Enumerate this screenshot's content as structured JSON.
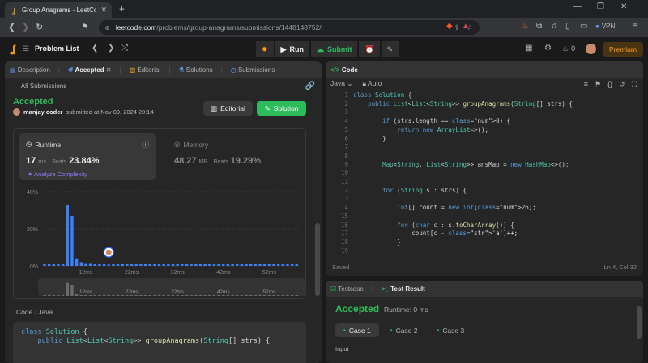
{
  "browser": {
    "tab_title": "Group Anagrams - LeetCode",
    "url_host": "leetcode.com",
    "url_path": "/problems/group-anagrams/submissions/1448148752/",
    "vpn_label": "VPN"
  },
  "lc_nav": {
    "problem_list": "Problem List",
    "run": "Run",
    "submit": "Submit",
    "streak": "0",
    "premium": "Premium"
  },
  "left_tabs": {
    "description": "Description",
    "accepted": "Accepted",
    "editorial": "Editorial",
    "solutions": "Solutions",
    "submissions": "Submissions"
  },
  "submission": {
    "back": "All Submissions",
    "status": "Accepted",
    "user": "manjay coder",
    "submitted_text": "submitted at Nov 09, 2024 20:14",
    "editorial_btn": "Editorial",
    "solution_btn": "Solution",
    "runtime": {
      "label": "Runtime",
      "value": "17",
      "unit": "ms",
      "beats_label": "Beats",
      "beats": "23.84%",
      "analyze": "Analyze Complexity"
    },
    "memory": {
      "label": "Memory",
      "value": "48.27",
      "unit": "MB",
      "beats_label": "Beats",
      "beats": "19.29%"
    },
    "code_label": "Code",
    "code_lang": "Java",
    "code_preview": [
      "class Solution {",
      "    public List<List<String>> groupAnagrams(String[] strs) {"
    ]
  },
  "chart_data": {
    "type": "bar",
    "yticks": [
      "40%",
      "20%",
      "0%"
    ],
    "ylim": [
      0,
      40
    ],
    "xticks": [
      "12ms",
      "22ms",
      "32ms",
      "42ms",
      "52ms"
    ],
    "x": [
      3,
      4,
      5,
      6,
      7,
      8,
      9,
      10,
      11,
      12,
      13,
      14,
      15,
      16,
      17,
      18,
      19,
      20,
      21,
      22,
      23,
      24,
      25,
      26,
      27,
      28,
      29,
      30,
      31,
      32,
      33,
      34,
      35,
      36,
      37,
      38,
      39,
      40,
      41,
      42,
      43,
      44,
      45,
      46,
      47,
      48,
      49,
      50,
      51,
      52,
      53,
      54,
      55,
      56,
      57,
      58
    ],
    "values": [
      1,
      1,
      1,
      1,
      1,
      33,
      27,
      4,
      2,
      1.5,
      1.5,
      1,
      1,
      1,
      1,
      1,
      1,
      1,
      1,
      1,
      1,
      1,
      1,
      1,
      1,
      1,
      1,
      1,
      1,
      1,
      1,
      1,
      1,
      1,
      1,
      1,
      1,
      1,
      1,
      1,
      1,
      1,
      1,
      1,
      1,
      1,
      1,
      1,
      1,
      1,
      1,
      1,
      1,
      1,
      1,
      1
    ],
    "highlight_x": 17,
    "highlight_value": 3
  },
  "code_panel": {
    "title": "Code",
    "lang": "Java",
    "mode": "Auto",
    "saved": "Saved",
    "cursor": "Ln 4, Col 32",
    "line_numbers": [
      "1",
      "2",
      "3",
      "4",
      "5",
      "6",
      "7",
      "8",
      "9",
      "10",
      "11",
      "12",
      "13",
      "14",
      "15",
      "16",
      "17",
      "18",
      "19"
    ],
    "lines": [
      "class Solution {",
      "    public List<List<String>> groupAnagrams(String[] strs) {",
      "",
      "        if (strs.length == 0) {",
      "            return new ArrayList<>();",
      "        }",
      "",
      "",
      "        Map<String, List<String>> ansMap = new HashMap<>();",
      "",
      "",
      "        for (String s : strs) {",
      "",
      "            int[] count = new int[26];",
      "",
      "            for (char c : s.toCharArray()) {",
      "                count[c - 'a']++;",
      "            }",
      ""
    ]
  },
  "result_panel": {
    "testcase_tab": "Testcase",
    "result_tab": "Test Result",
    "status": "Accepted",
    "runtime": "Runtime: 0 ms",
    "cases": [
      "Case 1",
      "Case 2",
      "Case 3"
    ],
    "input_label": "Input"
  },
  "colors": {
    "accent_green": "#2cbb5d",
    "brand_orange": "#ffa116",
    "bar_blue": "#3b82f6"
  }
}
